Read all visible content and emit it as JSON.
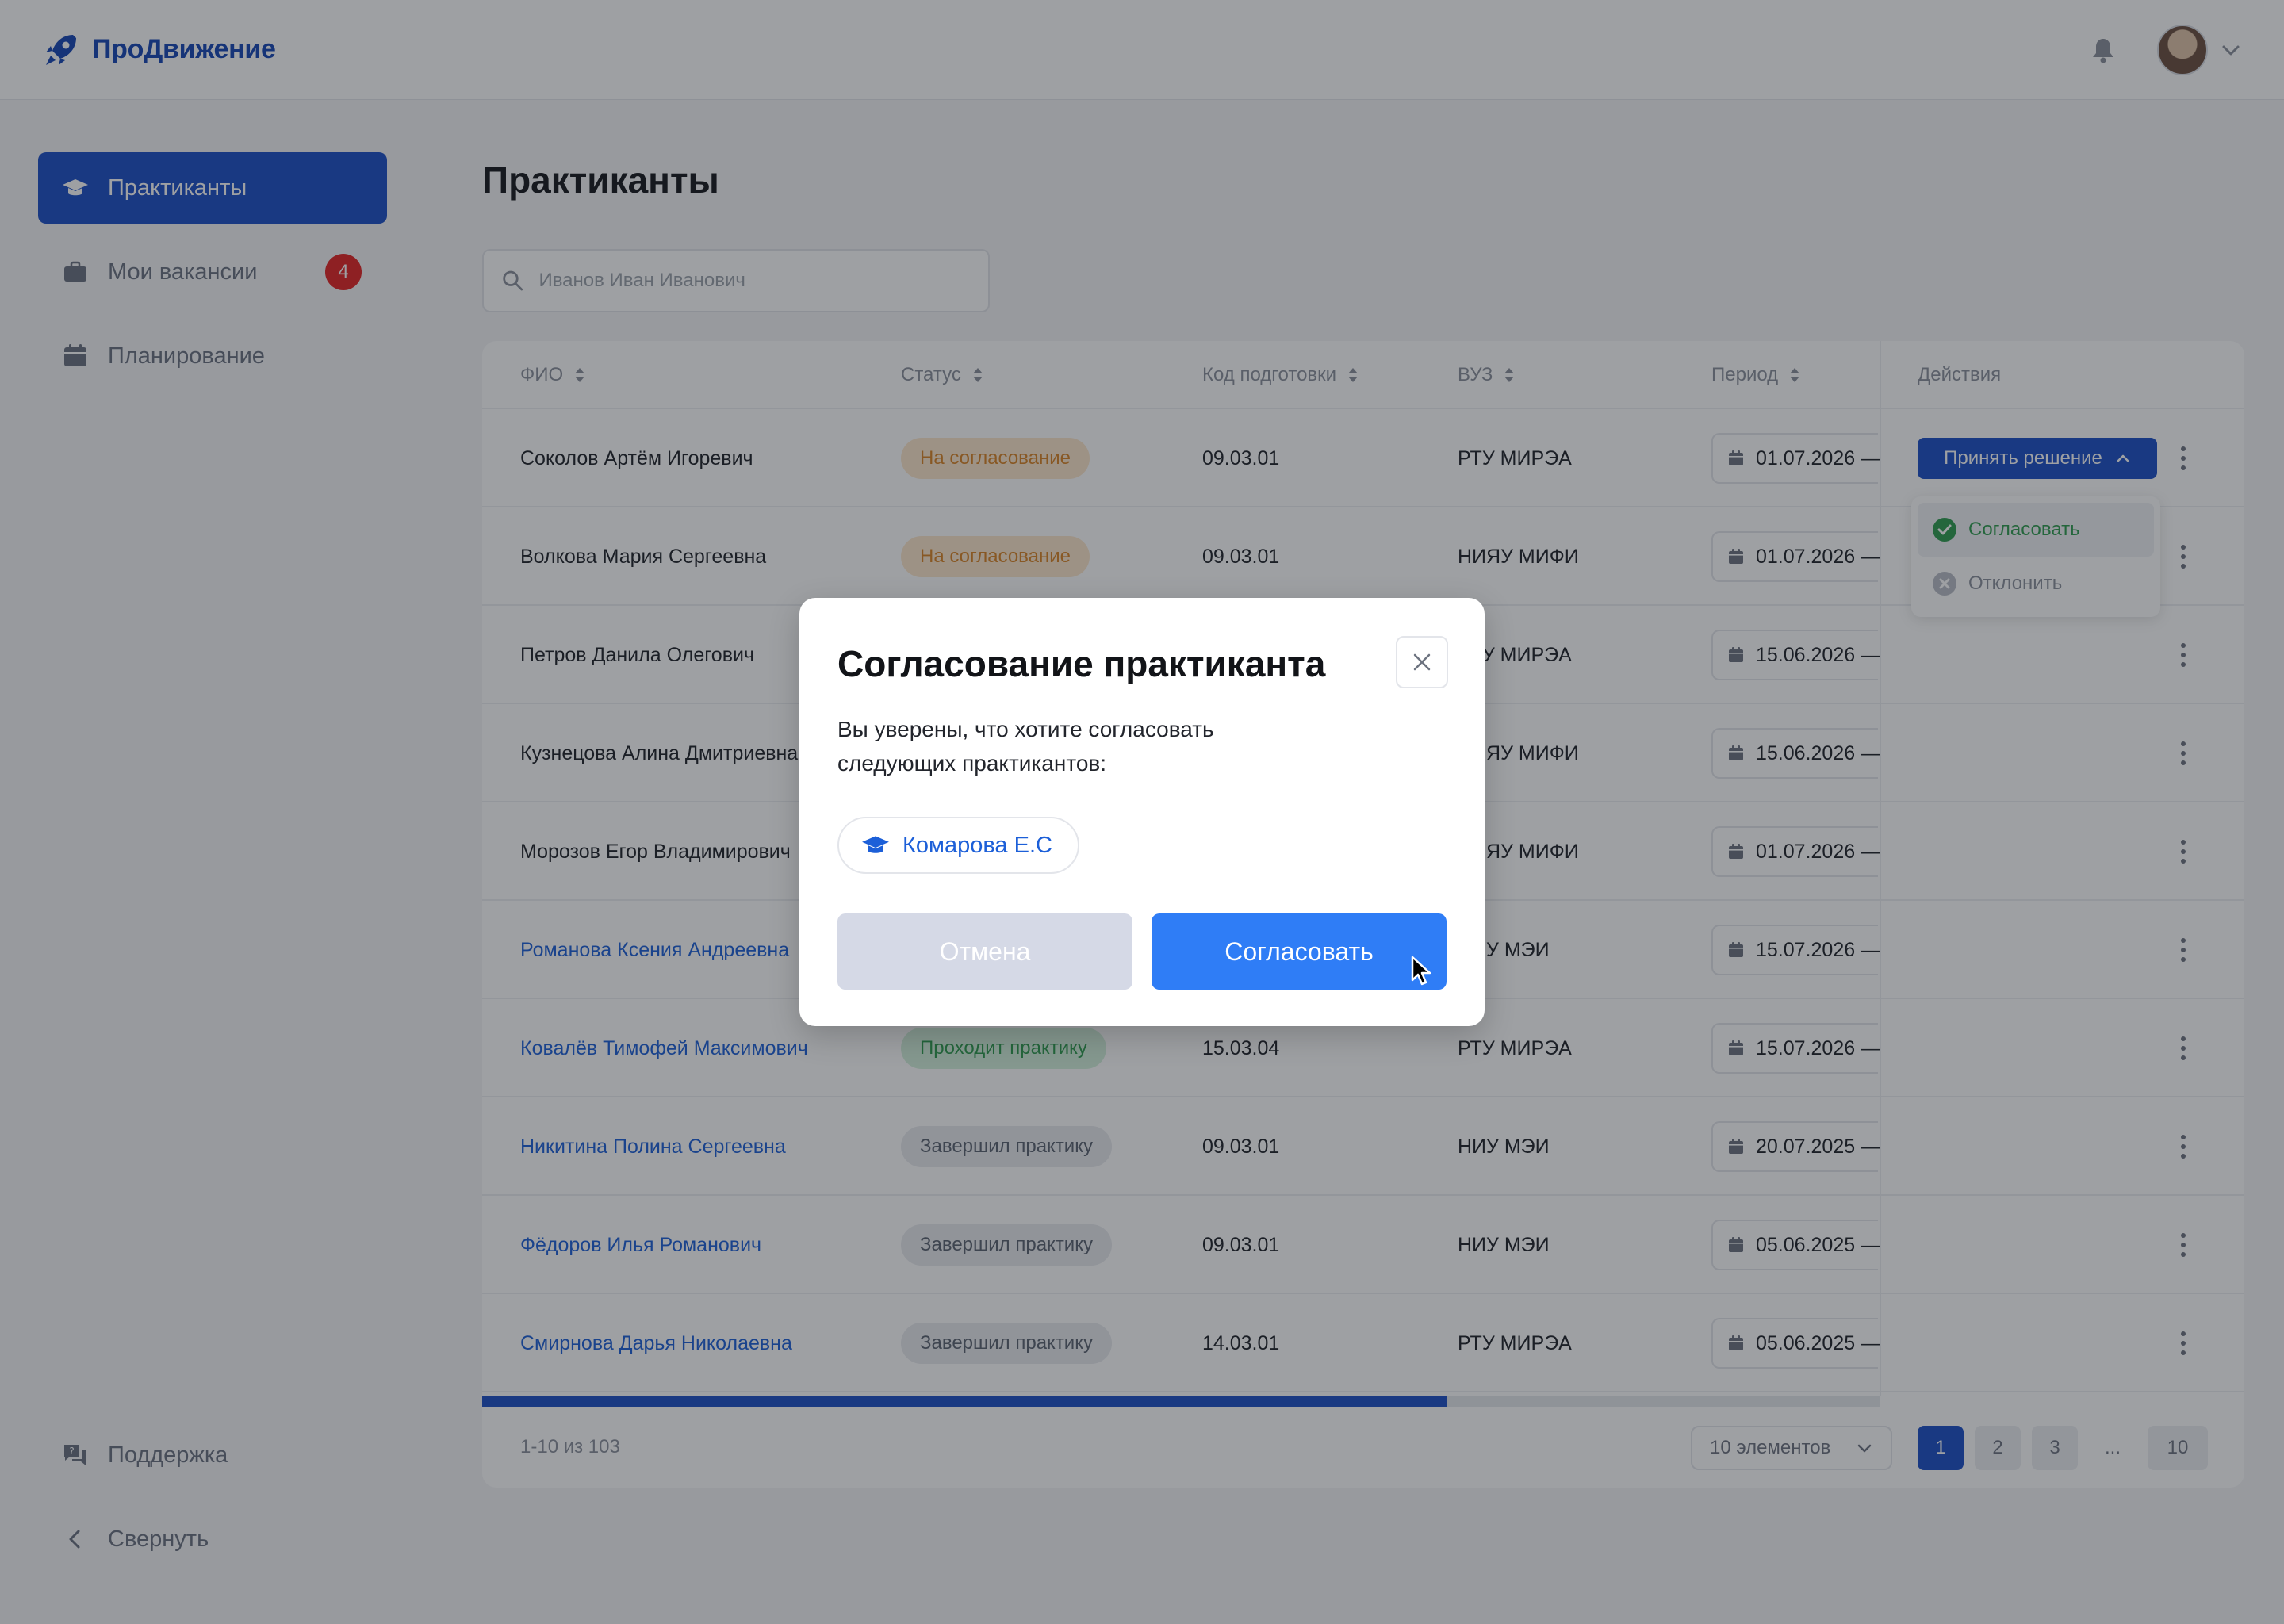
{
  "app": {
    "brand": "ПроДвижение"
  },
  "colors": {
    "primary": "#1a4fc7",
    "link": "#1c5fd8",
    "badge": "#e32323",
    "approve_button": "#2f7df6"
  },
  "sidebar": {
    "items": [
      {
        "label": "Практиканты",
        "icon": "graduation-cap-icon",
        "active": true
      },
      {
        "label": "Мои вакансии",
        "icon": "briefcase-icon",
        "badge": "4"
      },
      {
        "label": "Планирование",
        "icon": "calendar-icon"
      }
    ],
    "bottom": [
      {
        "label": "Поддержка",
        "icon": "support-chat-icon"
      },
      {
        "label": "Свернуть",
        "icon": "chevron-left-icon"
      }
    ]
  },
  "page": {
    "title": "Практиканты"
  },
  "search": {
    "placeholder": "Иванов Иван Иванович"
  },
  "table": {
    "columns": [
      "ФИО",
      "Статус",
      "Код подготовки",
      "ВУЗ",
      "Период",
      "Действия"
    ],
    "rows": [
      {
        "name": "Соколов Артём Игоревич",
        "status": "На согласование",
        "code": "09.03.01",
        "uni": "РТУ МИРЭА",
        "period": "01.07.2026 —"
      },
      {
        "name": "Волкова Мария Сергеевна",
        "status": "На согласование",
        "code": "09.03.01",
        "uni": "НИЯУ МИФИ",
        "period": "01.07.2026 —"
      },
      {
        "name": "Петров Данила Олегович",
        "status": "",
        "code": "",
        "uni": "РТУ МИРЭА",
        "period": "15.06.2026 —"
      },
      {
        "name": "Кузнецова Алина Дмитриевна",
        "status": "",
        "code": "",
        "uni": "НИЯУ МИФИ",
        "period": "15.06.2026 —"
      },
      {
        "name": "Морозов Егор Владимирович",
        "status": "",
        "code": "",
        "uni": "НИЯУ МИФИ",
        "period": "01.07.2026 —"
      },
      {
        "name": "Романова Ксения Андреевна",
        "status": "",
        "code": "",
        "uni": "НИУ МЭИ",
        "period": "15.07.2026 —"
      },
      {
        "name": "Ковалёв Тимофей Максимович",
        "status": "Проходит практику",
        "code": "15.03.04",
        "uni": "РТУ МИРЭА",
        "period": "15.07.2026 —"
      },
      {
        "name": "Никитина Полина Сергеевна",
        "status": "Завершил практику",
        "code": "09.03.01",
        "uni": "НИУ МЭИ",
        "period": "20.07.2025 —"
      },
      {
        "name": "Фёдоров Илья Романович",
        "status": "Завершил практику",
        "code": "09.03.01",
        "uni": "НИУ МЭИ",
        "period": "05.06.2025 —"
      },
      {
        "name": "Смирнова Дарья Николаевна",
        "status": "Завершил практику",
        "code": "14.03.01",
        "uni": "РТУ МИРЭА",
        "period": "05.06.2025 —"
      }
    ],
    "decision_button": "Принять решение",
    "decision_menu": [
      {
        "label": "Согласовать",
        "icon": "check-circle-icon"
      },
      {
        "label": "Отклонить",
        "icon": "x-circle-icon"
      }
    ],
    "scroll_fraction": 0.69
  },
  "footer": {
    "range": "1-10 из 103",
    "page_size": "10 элементов",
    "pages": [
      "1",
      "2",
      "3",
      "...",
      "10"
    ]
  },
  "modal": {
    "title": "Согласование практиканта",
    "text_line1": "Вы уверены, что хотите согласовать",
    "text_line2": "следующих практикантов:",
    "chip": "Комарова Е.С",
    "cancel": "Отмена",
    "approve": "Согласовать"
  }
}
